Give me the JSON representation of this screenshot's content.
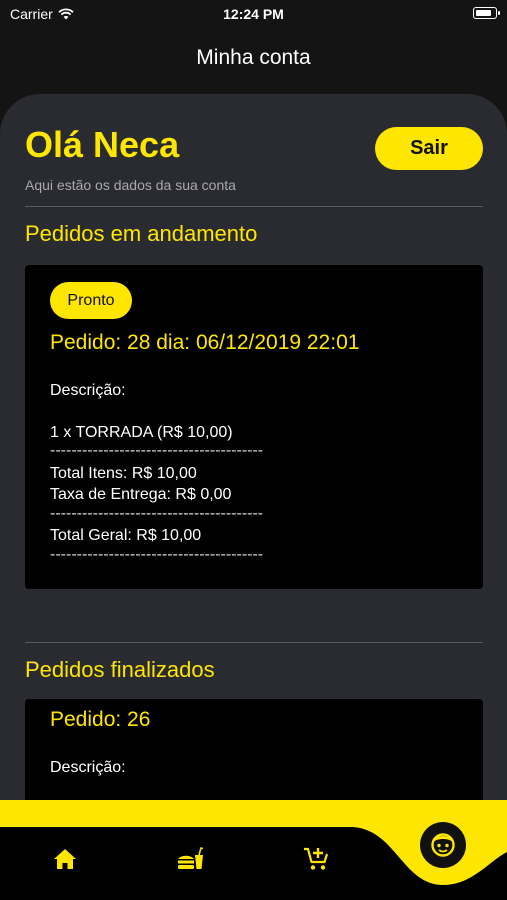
{
  "status_bar": {
    "carrier": "Carrier",
    "time": "12:24 PM"
  },
  "header": {
    "title": "Minha conta"
  },
  "account": {
    "greeting": "Olá Neca",
    "subtitle": "Aqui estão os dados da sua conta",
    "logout_label": "Sair"
  },
  "sections": {
    "in_progress_title": "Pedidos em andamento",
    "finished_title": "Pedidos finalizados"
  },
  "active_order": {
    "status": "Pronto",
    "header": "Pedido: 28 dia: 06/12/2019 22:01",
    "description_label": "Descrição:",
    "item": "1 x TORRADA (R$ 10,00)",
    "separator": "----------------------------------------",
    "total_items": "Total Itens: R$ 10,00",
    "delivery_fee": "Taxa de Entrega: R$ 0,00",
    "grand_total": "Total Geral: R$ 10,00"
  },
  "finished_order": {
    "header": "Pedido: 26",
    "description_label": "Descrição:"
  },
  "tabbar": {
    "tabs": [
      {
        "icon": "home-icon"
      },
      {
        "icon": "menu-food-icon"
      },
      {
        "icon": "add-to-cart-icon"
      },
      {
        "icon": "profile-icon"
      }
    ]
  },
  "colors": {
    "accent": "#ffe600",
    "panel": "#2a2b31",
    "card": "#000000",
    "background": "#141414"
  }
}
